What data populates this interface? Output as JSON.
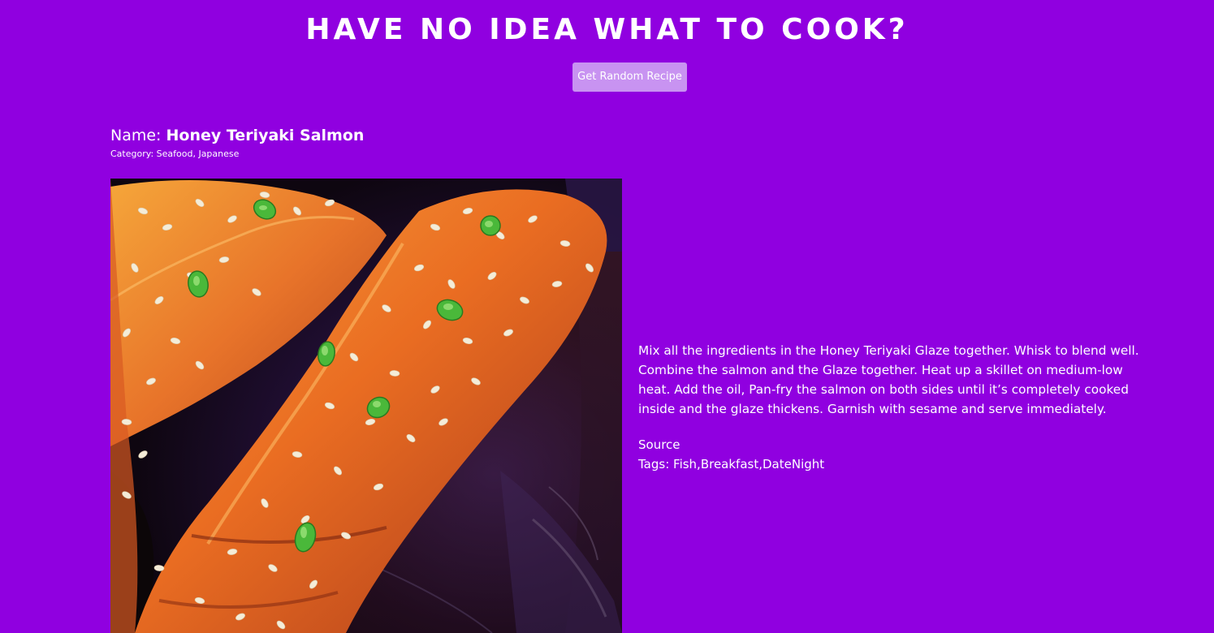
{
  "header": {
    "title": "HAVE NO IDEA WHAT TO COOK?",
    "button_label": "Get Random Recipe"
  },
  "recipe": {
    "name_label": "Name: ",
    "name": "Honey Teriyaki Salmon",
    "category": "Category: Seafood, Japanese",
    "image_subject": "glazed salmon fillets with sesame seeds and green onions",
    "instructions": "Mix all the ingredients in the Honey Teriyaki Glaze together. Whisk to blend well. Combine the salmon and the Glaze together. Heat up a skillet on medium-low heat. Add the oil, Pan-fry the salmon on both sides until it’s completely cooked inside and the glaze thickens. Garnish with sesame and serve immediately.",
    "source_label": "Source",
    "tags": "Tags: Fish,Breakfast,DateNight"
  },
  "colors": {
    "background": "#9000e0",
    "button": "#c893f1",
    "text": "#ffffff"
  }
}
